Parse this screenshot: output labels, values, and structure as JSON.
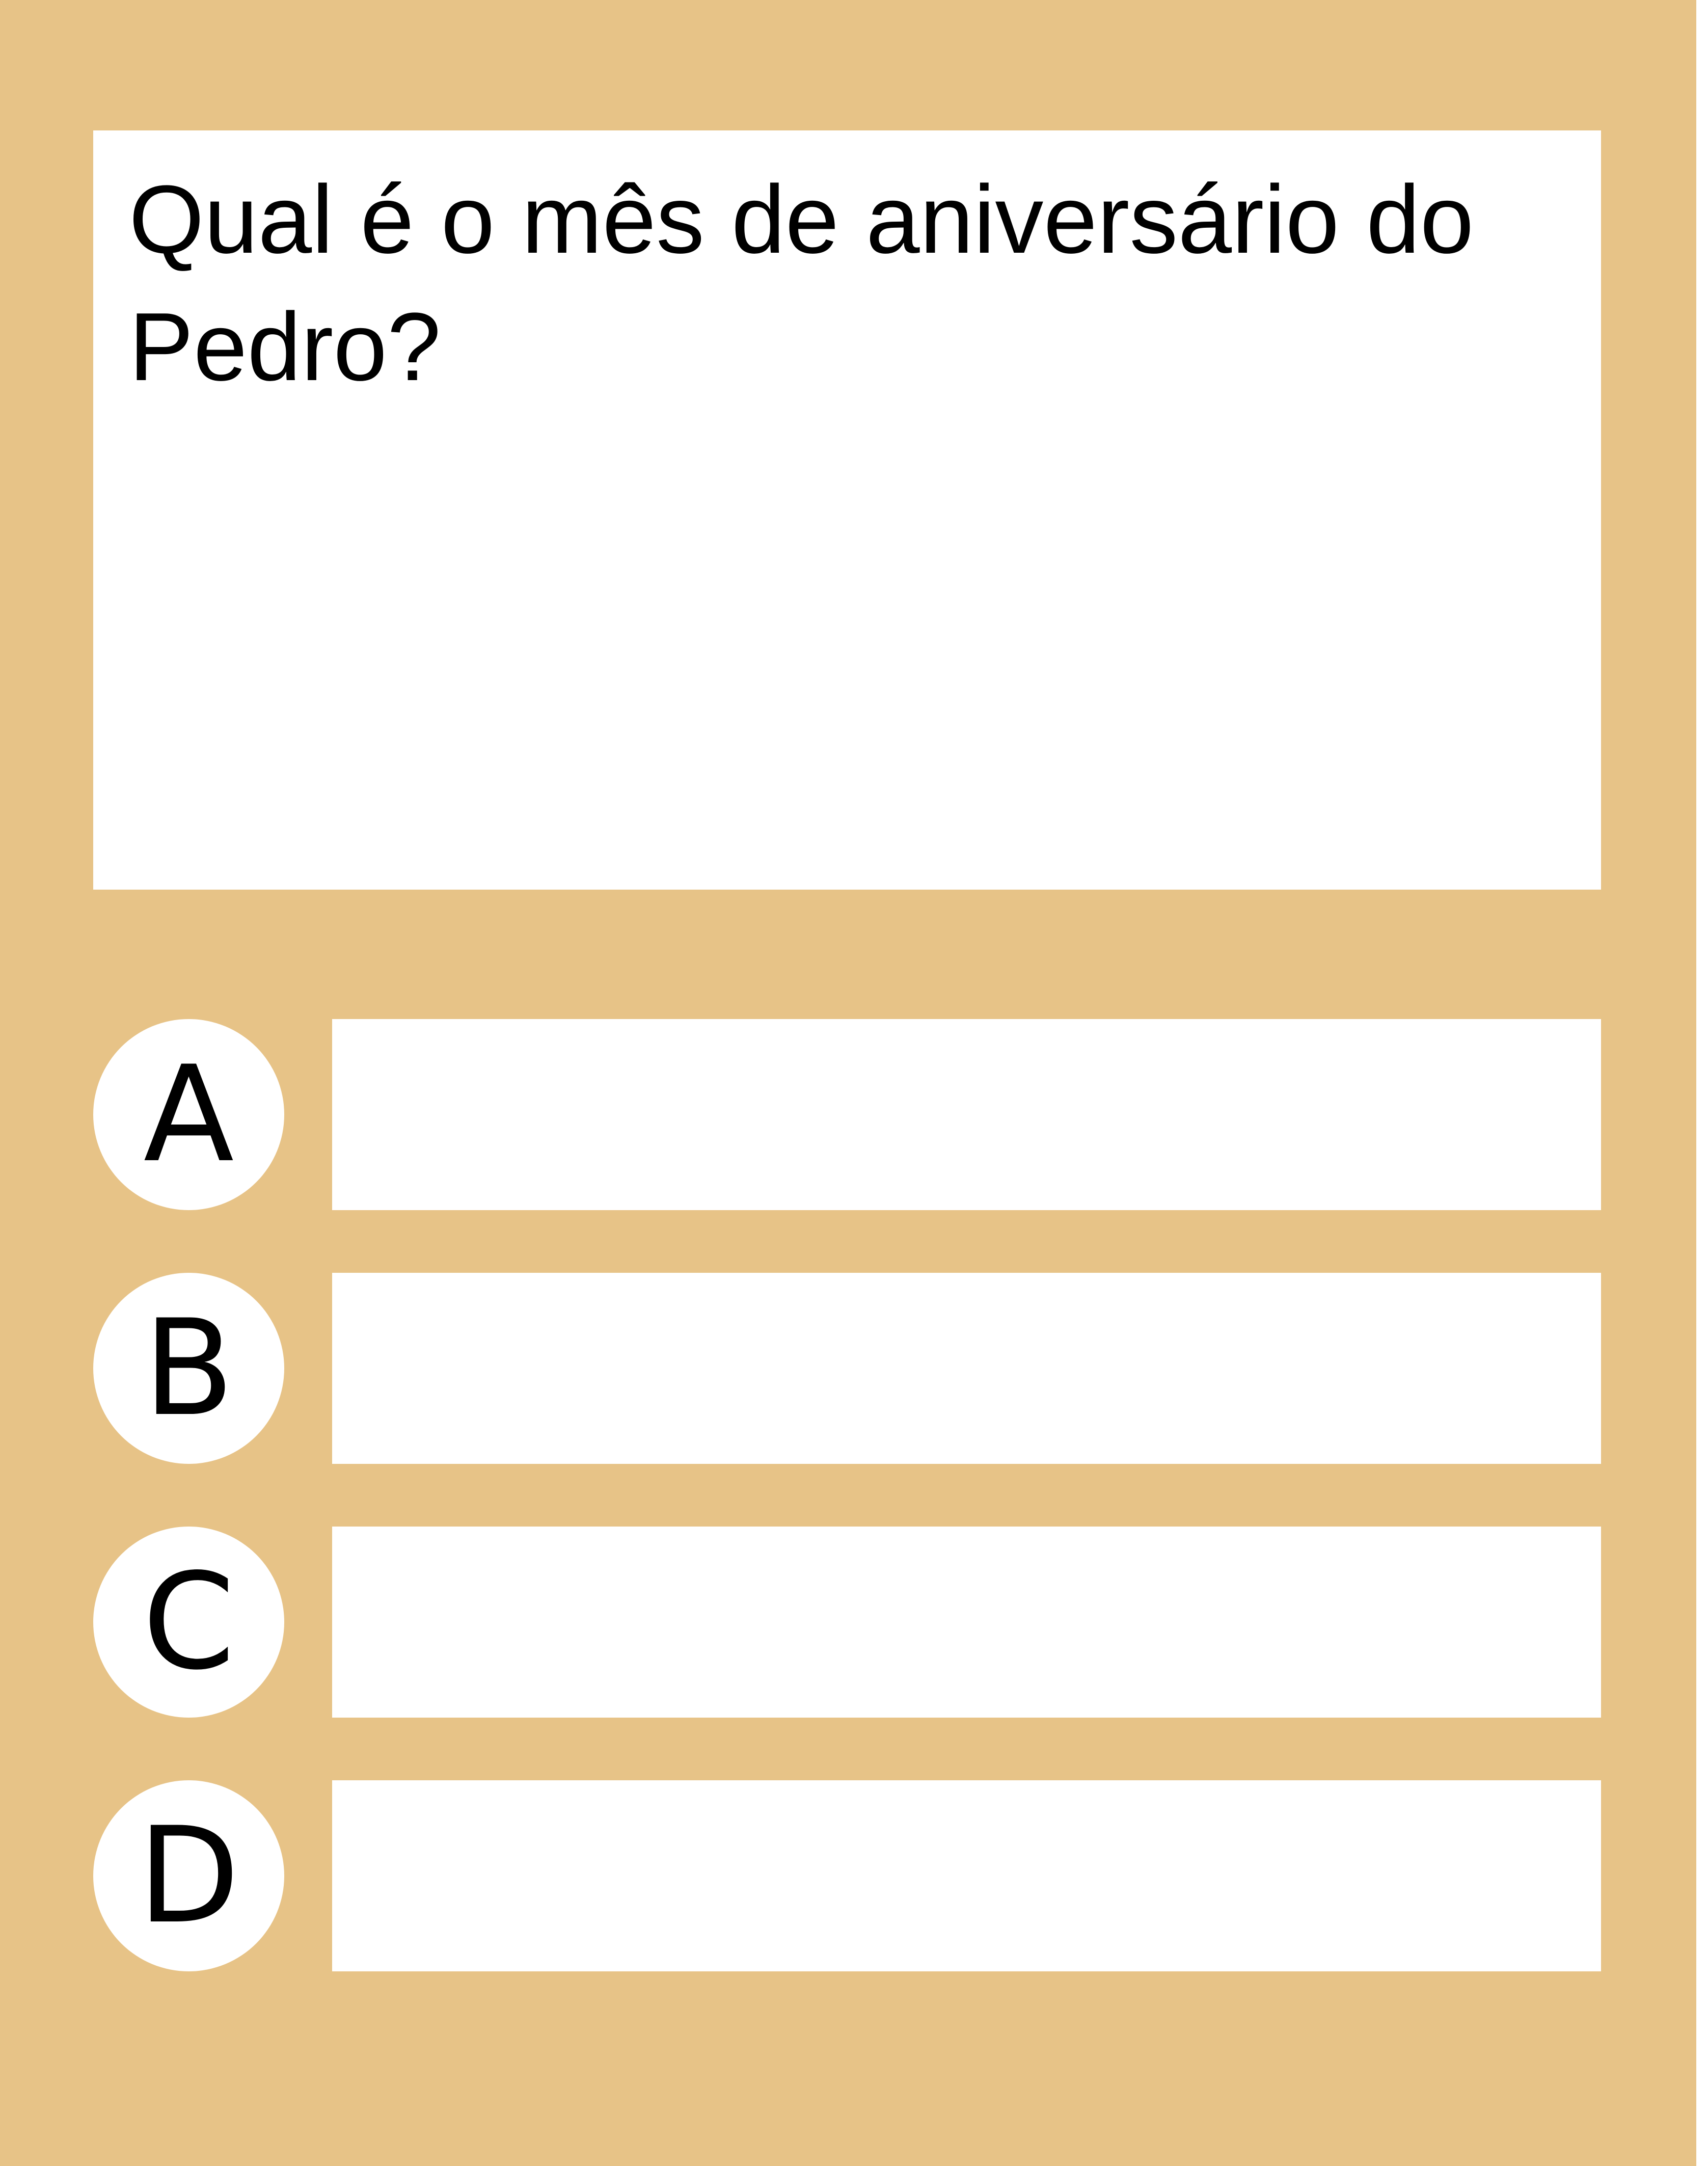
{
  "question": {
    "text": "Qual é o mês de aniversário do Pedro?"
  },
  "options": [
    {
      "letter": "A",
      "text": ""
    },
    {
      "letter": "B",
      "text": ""
    },
    {
      "letter": "C",
      "text": ""
    },
    {
      "letter": "D",
      "text": ""
    }
  ],
  "colors": {
    "background": "#e7c387",
    "panel": "#ffffff",
    "text": "#000000"
  }
}
